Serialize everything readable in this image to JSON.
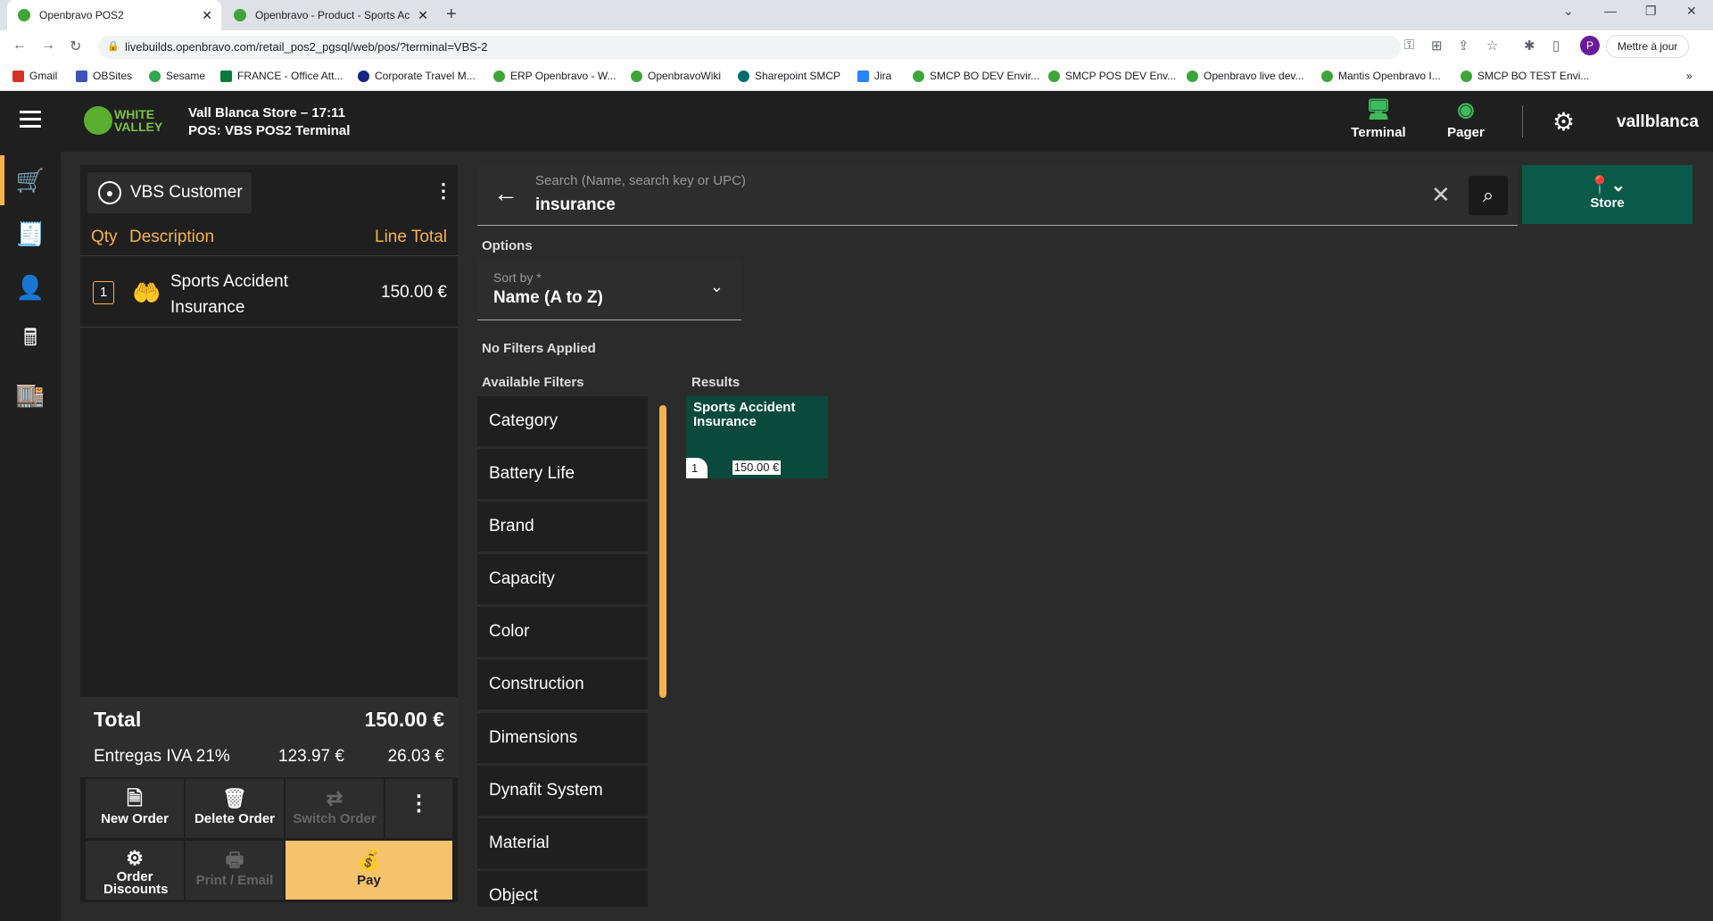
{
  "browser": {
    "tabs": [
      {
        "title": "Openbravo POS2"
      },
      {
        "title": "Openbravo - Product - Sports Ac"
      }
    ],
    "url": "livebuilds.openbravo.com/retail_pos2_pgsql/web/pos/?terminal=VBS-2",
    "profile_initial": "P",
    "update_label": "Mettre à jour",
    "bookmarks": [
      "Gmail",
      "OBSites",
      "Sesame",
      "FRANCE - Office Att...",
      "Corporate Travel M...",
      "ERP Openbravo - W...",
      "OpenbravoWiki",
      "Sharepoint SMCP",
      "Jira",
      "SMCP BO DEV Envir...",
      "SMCP POS DEV Env...",
      "Openbravo live dev...",
      "Mantis Openbravo I...",
      "SMCP BO TEST Envi..."
    ]
  },
  "header": {
    "logo_line1": "WHITE",
    "logo_line2": "VALLEY",
    "store_line": "Vall Blanca Store – 17:11",
    "pos_line": "POS: VBS POS2 Terminal",
    "terminal_label": "Terminal",
    "pager_label": "Pager",
    "username": "vallblanca"
  },
  "ticket": {
    "customer": "VBS Customer",
    "col_qty": "Qty",
    "col_desc": "Description",
    "col_total": "Line Total",
    "lines": [
      {
        "qty": "1",
        "description": "Sports Accident Insurance",
        "total": "150.00 €"
      }
    ],
    "total_label": "Total",
    "total_value": "150.00 €",
    "tax_label": "Entregas IVA 21%",
    "tax_base": "123.97 €",
    "tax_amount": "26.03 €",
    "actions": {
      "new_order": "New Order",
      "delete_order": "Delete Order",
      "switch_order": "Switch Order",
      "order_discounts": "Order Discounts",
      "print_email": "Print / Email",
      "pay": "Pay"
    }
  },
  "search": {
    "placeholder": "Search (Name, search key or UPC)",
    "value": "insurance",
    "store_label": "Store"
  },
  "options": {
    "title": "Options",
    "sort_label": "Sort by *",
    "sort_value": "Name (A to Z)",
    "no_filters": "No Filters Applied",
    "available_filters_label": "Available Filters",
    "filters": [
      "Category",
      "Battery Life",
      "Brand",
      "Capacity",
      "Color",
      "Construction",
      "Dimensions",
      "Dynafit System",
      "Material",
      "Object"
    ]
  },
  "results": {
    "label": "Results",
    "items": [
      {
        "name": "Sports Accident Insurance",
        "qty": "1",
        "price": "150.00 €"
      }
    ]
  },
  "colors": {
    "accent": "#f6b24c",
    "store_button": "#0a5a4a",
    "card": "#0a4a3c"
  }
}
